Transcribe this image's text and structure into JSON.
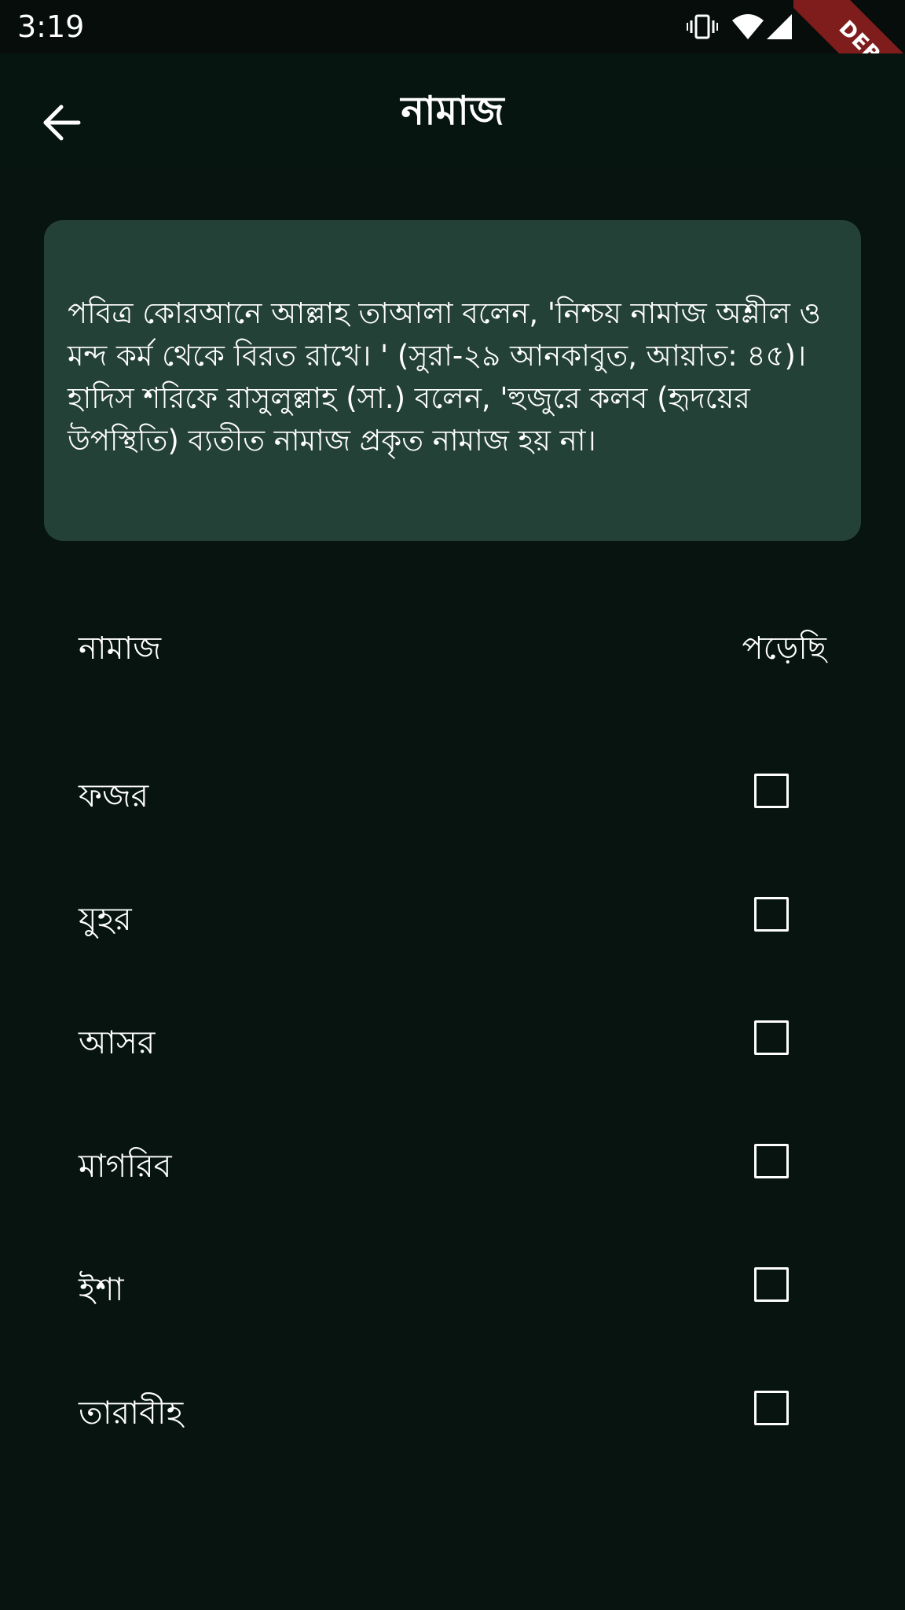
{
  "status_bar": {
    "time": "3:19",
    "icons": [
      "vibrate-icon",
      "wifi-icon",
      "signal-icon"
    ]
  },
  "debug_banner": {
    "label": "DEBUG"
  },
  "app_bar": {
    "back_icon": "arrow-left-icon",
    "title": "নামাজ"
  },
  "info_card": {
    "text": "পবিত্র কোরআনে আল্লাহ তাআলা বলেন, 'নিশ্চয় নামাজ অশ্লীল ও মন্দ কর্ম থেকে বিরত রাখে। ' (সুরা-২৯ আনকাবুত, আয়াত: ৪৫)। হাদিস শরিফে রাসুলুল্লাহ (সা.) বলেন, 'হুজুরে কলব (হৃদয়ের উপস্থিতি) ব্যতীত নামাজ প্রকৃত নামাজ হয় না।"
  },
  "table": {
    "header_left": "নামাজ",
    "header_right": "পড়েছি"
  },
  "prayers": [
    {
      "name": "ফজর",
      "checked": false
    },
    {
      "name": "যুহর",
      "checked": false
    },
    {
      "name": "আসর",
      "checked": false
    },
    {
      "name": "মাগরিব",
      "checked": false
    },
    {
      "name": "ইশা",
      "checked": false
    },
    {
      "name": "তারাবীহ",
      "checked": false
    }
  ],
  "colors": {
    "background": "#071410",
    "card": "#244137",
    "debug": "#7f1d1d"
  }
}
